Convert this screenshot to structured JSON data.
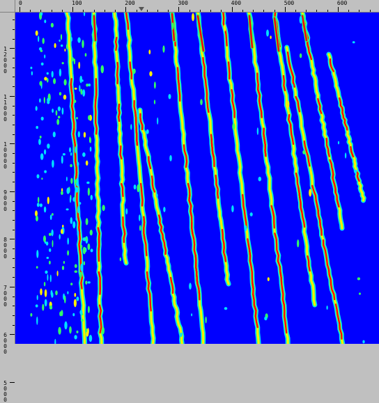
{
  "top_ruler": {
    "labels": [
      "0",
      "100",
      "200",
      "300",
      "400",
      "500",
      "600"
    ],
    "marker_value": 230
  },
  "left_ruler": {
    "labels": [
      "12000",
      "11000",
      "10000",
      "9000",
      "8000",
      "7000",
      "6000",
      "5000"
    ]
  },
  "colors": {
    "background": "#0000ff",
    "low": "#00e0ff",
    "mid": "#33ff66",
    "high": "#ffee00",
    "peak": "#ff0000"
  }
}
